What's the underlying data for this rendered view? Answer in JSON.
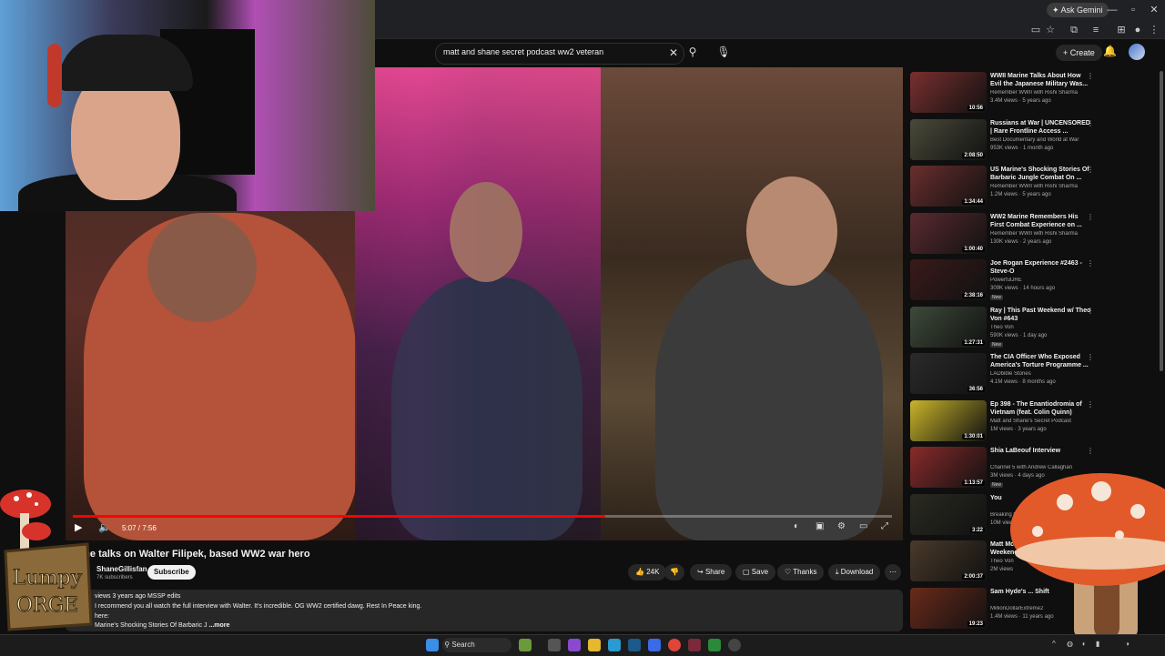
{
  "browser": {
    "ask_gemini": "Ask Gemini"
  },
  "header": {
    "search_query": "matt and shane secret podcast ww2 veteran",
    "create_label": "Create"
  },
  "player": {
    "time": "5:07 / 7:56",
    "progress_fraction": 0.65
  },
  "video": {
    "title": "Shane talks on Walter Filipek, based WW2 war hero",
    "channel_name": "ShaneGillisfan",
    "subscribers": "7K subscribers",
    "subscribe_label": "Subscribe",
    "likes": "24K",
    "share_label": "Share",
    "save_label": "Save",
    "thanks_label": "Thanks",
    "download_label": "Download",
    "desc_meta": "views 3 years ago  MSSP edits",
    "desc_line1": "I recommend you all watch the full interview with Walter. It's incredible. OG WW2 certified dawg. Rest In Peace king.",
    "desc_line2": "here:",
    "desc_line3": "Marine's Shocking Stories Of Barbaric J",
    "more_label": "...more"
  },
  "overlay": {
    "logo_line1": "Lumpy",
    "logo_line2": "ORGE"
  },
  "recommendations": [
    {
      "title": "WWII Marine Talks About How Evil the Japanese Military Was...",
      "channel": "Remember WWII with Rishi Sharma",
      "meta": "3.4M views · 5 years ago",
      "duration": "10:56",
      "new": "",
      "color": "#7a2f2f"
    },
    {
      "title": "Russians at War | UNCENSORED | Rare Frontline Access ...",
      "channel": "Best Documentary and World at War",
      "meta": "953K views · 1 month ago",
      "duration": "2:08:50",
      "new": "",
      "color": "#4a4a3a"
    },
    {
      "title": "US Marine's Shocking Stories Of Barbaric Jungle Combat On ...",
      "channel": "Remember WWII with Rishi Sharma",
      "meta": "1.2M views · 5 years ago",
      "duration": "1:34:44",
      "new": "",
      "color": "#6a2e2e"
    },
    {
      "title": "WW2 Marine Remembers His First Combat Experience on ...",
      "channel": "Remember WWII with Rishi Sharma",
      "meta": "130K views · 2 years ago",
      "duration": "1:00:40",
      "new": "",
      "color": "#5a2a30"
    },
    {
      "title": "Joe Rogan Experience #2463 - Steve-O",
      "channel": "PowerfulJRE",
      "meta": "309K views · 14 hours ago",
      "duration": "2:38:16",
      "new": "New",
      "color": "#3a1a1a"
    },
    {
      "title": "Ray | This Past Weekend w/ Theo Von #643",
      "channel": "Theo Von",
      "meta": "590K views · 1 day ago",
      "duration": "1:27:31",
      "new": "New",
      "color": "#3d4a3a"
    },
    {
      "title": "The CIA Officer Who Exposed America's Torture Programme ...",
      "channel": "LADbible Stories",
      "meta": "4.1M views · 8 months ago",
      "duration": "36:56",
      "new": "",
      "color": "#2a2a2a"
    },
    {
      "title": "Ep 398 - The Enantiodromia of Vietnam (feat. Colin Quinn)",
      "channel": "Matt and Shane's Secret Podcast",
      "meta": "1M views · 3 years ago",
      "duration": "1:30:01",
      "new": "",
      "color": "#c9b52a"
    },
    {
      "title": "Shia LaBeouf Interview",
      "channel": "Channel 5 with Andrew Callaghan",
      "meta": "3M views · 4 days ago",
      "duration": "1:13:57",
      "new": "New",
      "color": "#8a2a2a"
    },
    {
      "title": "You",
      "channel": "Breaking Benjamin",
      "meta": "10M views · 7 years ago",
      "duration": "3:22",
      "new": "",
      "color": "#2a2a22"
    },
    {
      "title": "Matt McCusker | This Past Weekend",
      "channel": "Theo Von",
      "meta": "2M views",
      "duration": "2:00:37",
      "new": "",
      "color": "#4a3a2a"
    },
    {
      "title": "Sam Hyde's ... Shift",
      "channel": "MillionDollarExtreme2",
      "meta": "1.4M views · 11 years ago",
      "duration": "19:23",
      "new": "",
      "color": "#6a2a1a"
    }
  ],
  "taskbar": {
    "search_label": "Search"
  }
}
